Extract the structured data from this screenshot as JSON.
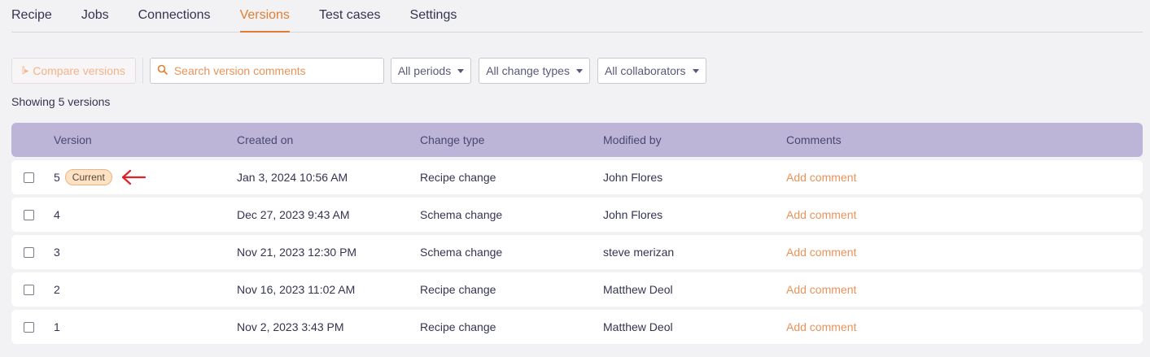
{
  "tabs": [
    {
      "label": "Recipe",
      "active": false
    },
    {
      "label": "Jobs",
      "active": false
    },
    {
      "label": "Connections",
      "active": false
    },
    {
      "label": "Versions",
      "active": true
    },
    {
      "label": "Test cases",
      "active": false
    },
    {
      "label": "Settings",
      "active": false
    }
  ],
  "toolbar": {
    "compare_label": "Compare versions",
    "search_placeholder": "Search version comments",
    "filter_periods": "All periods",
    "filter_change_types": "All change types",
    "filter_collaborators": "All collaborators"
  },
  "summary": "Showing 5 versions",
  "table": {
    "headers": [
      "Version",
      "Created on",
      "Change type",
      "Modified by",
      "Comments"
    ],
    "current_badge": "Current",
    "rows": [
      {
        "version": "5",
        "created": "Jan 3, 2024 10:56 AM",
        "change_type": "Recipe change",
        "modified_by": "John Flores",
        "comment": "Add comment"
      },
      {
        "version": "4",
        "created": "Dec 27, 2023 9:43 AM",
        "change_type": "Schema change",
        "modified_by": "John Flores",
        "comment": "Add comment"
      },
      {
        "version": "3",
        "created": "Nov 21, 2023 12:30 PM",
        "change_type": "Schema change",
        "modified_by": "steve merizan",
        "comment": "Add comment"
      },
      {
        "version": "2",
        "created": "Nov 16, 2023 11:02 AM",
        "change_type": "Recipe change",
        "modified_by": "Matthew Deol",
        "comment": "Add comment"
      },
      {
        "version": "1",
        "created": "Nov 2, 2023 3:43 PM",
        "change_type": "Recipe change",
        "modified_by": "Matthew Deol",
        "comment": "Add comment"
      }
    ]
  },
  "colors": {
    "accent": "#e47d31",
    "header_bg": "#bcb5d8",
    "annotation_arrow": "#e0202a"
  },
  "icons": {
    "compare": "compare-icon",
    "search": "search-icon",
    "caret": "chevron-down-icon",
    "annotation": "arrow-left-icon"
  }
}
